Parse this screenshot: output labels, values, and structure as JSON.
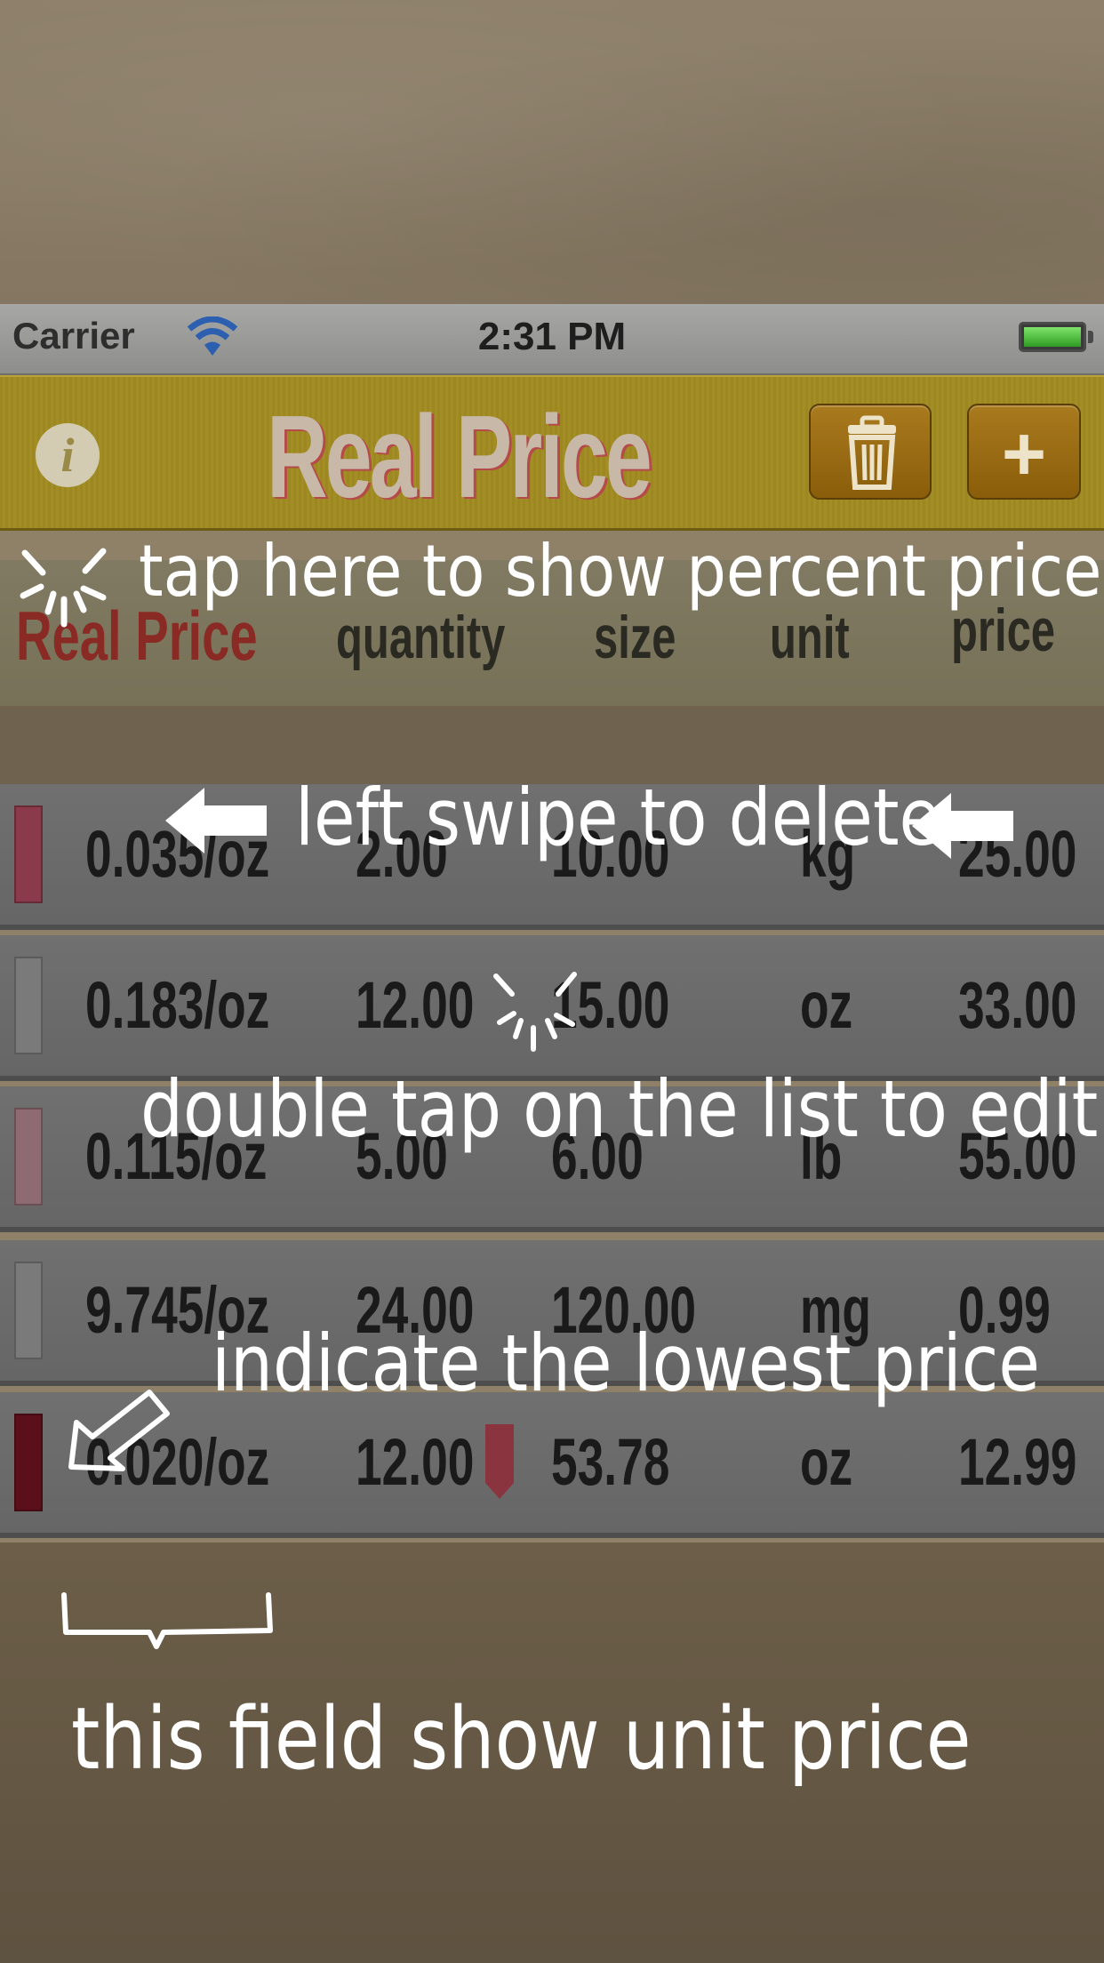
{
  "status_bar": {
    "carrier": "Carrier",
    "time": "2:31 PM"
  },
  "nav": {
    "title": "Real Price"
  },
  "header": {
    "title": "Real Price",
    "quantity": "quantity",
    "size": "size",
    "unit": "unit",
    "price": "price"
  },
  "rows": [
    {
      "unit_price": "0.035/oz",
      "quantity": "2.00",
      "size": "10.00",
      "unit": "kg",
      "price": "25.00",
      "color": "#8a3a4a"
    },
    {
      "unit_price": "0.183/oz",
      "quantity": "12.00",
      "size": "15.00",
      "unit": "oz",
      "price": "33.00",
      "color": "#7a7a7a"
    },
    {
      "unit_price": "0.115/oz",
      "quantity": "5.00",
      "size": "6.00",
      "unit": "lb",
      "price": "55.00",
      "color": "#8e6a72"
    },
    {
      "unit_price": "9.745/oz",
      "quantity": "24.00",
      "size": "120.00",
      "unit": "mg",
      "price": "0.99",
      "color": "#7a7a7a"
    },
    {
      "unit_price": "0.020/oz",
      "quantity": "12.00",
      "size": "53.78",
      "unit": "oz",
      "price": "12.99",
      "color": "#5a0f1a"
    }
  ],
  "annotations": {
    "percent": "tap here to show percent price",
    "swipe": "left swipe to delete",
    "double_tap": "double tap on the list to edit",
    "lowest": "indicate the lowest price",
    "unit_price_field": "this field show unit price"
  },
  "colors": {
    "nav_bar": "#a08a22",
    "title_accent": "#b54a4a",
    "lowest_indicator": "#5a0f1a"
  }
}
